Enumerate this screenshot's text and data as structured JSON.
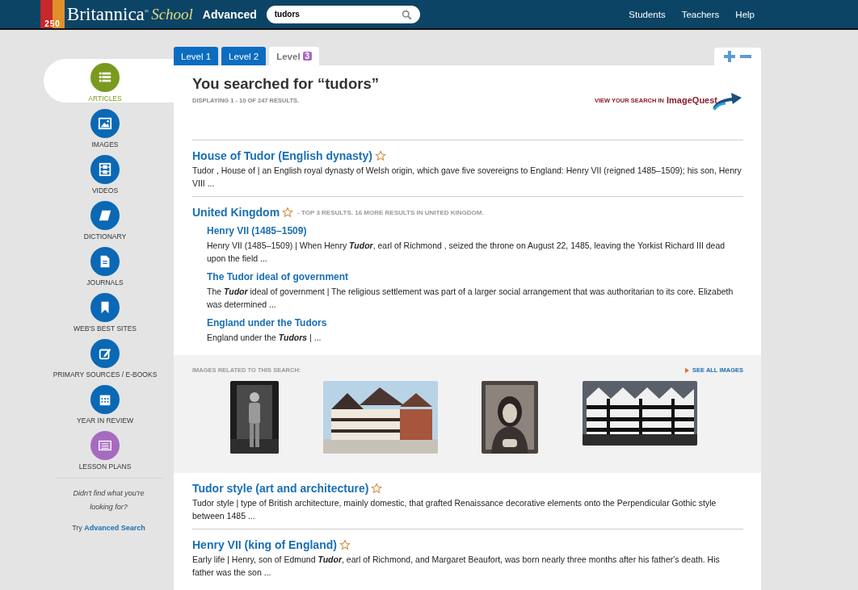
{
  "header": {
    "logo": {
      "anniversary": "250",
      "brand": "Britannica$^{®}$",
      "sub": "School"
    },
    "edition": "Advanced",
    "search": {
      "value": "tudors"
    },
    "nav": [
      "Students",
      "Teachers",
      "Help"
    ]
  },
  "tabs": [
    {
      "label": "Level 1",
      "selected": false
    },
    {
      "label": "Level 2",
      "selected": false
    },
    {
      "label": "Level",
      "badge": "3",
      "selected": true
    }
  ],
  "sidebar": {
    "items": [
      {
        "label": "ARTICLES",
        "color": "#7a9a1e",
        "selected": true
      },
      {
        "label": "IMAGES",
        "color": "#0b68b5",
        "selected": false
      },
      {
        "label": "VIDEOS",
        "color": "#0b68b5",
        "selected": false
      },
      {
        "label": "DICTIONARY",
        "color": "#0b68b5",
        "selected": false
      },
      {
        "label": "JOURNALS",
        "color": "#0b68b5",
        "selected": false
      },
      {
        "label": "WEB'S BEST SITES",
        "color": "#0b68b5",
        "selected": false
      },
      {
        "label": "PRIMARY SOURCES / E-BOOKS",
        "color": "#0b68b5",
        "selected": false
      },
      {
        "label": "YEAR IN REVIEW",
        "color": "#0b68b5",
        "selected": false
      },
      {
        "label": "LESSON PLANS",
        "color": "#a66bbf",
        "selected": false
      }
    ],
    "note": "Didn't find what you're looking for?",
    "try_prefix": "Try",
    "try_link": "Advanced Search"
  },
  "results_header": {
    "title": "You searched for “tudors”",
    "count": "DISPLAYING 1 - 10 OF 247 RESULTS.",
    "imagequest_prefix": "VIEW YOUR SEARCH IN",
    "imagequest_brand": "ImageQuest"
  },
  "results": [
    {
      "kind": "article",
      "title": "House of Tudor (English dynasty)",
      "text": "Tudor , House of  |   an English royal dynasty of Welsh origin, which gave five sovereigns to England: Henry VII (reigned 1485–1509); his son, Henry VIII ..."
    },
    {
      "kind": "group",
      "title": "United Kingdom",
      "note": "- TOP 3 RESULTS. 16 MORE RESULTS IN UNITED KINGDOM.",
      "children": [
        {
          "title": "Henry VII  (1485–1509)",
          "text": "Henry VII  (1485–1509)  | When Henry **Tudor**, earl of Richmond , seized the throne on August 22, 1485, leaving the Yorkist Richard III dead upon the field ..."
        },
        {
          "title": "The Tudor ideal of government",
          "text": "The **Tudor** ideal of government  | The religious settlement was part of a larger social arrangement that was authoritarian to its core. Elizabeth was determined ..."
        },
        {
          "title": "England under the Tudors",
          "text": "England under the **Tudors**   | ..."
        }
      ]
    },
    {
      "kind": "images",
      "label": "IMAGES RELATED TO THIS SEARCH:",
      "see_all": "SEE ALL IMAGES"
    },
    {
      "kind": "article",
      "title": "Tudor style (art and architecture)",
      "text": "Tudor style   |   type of British architecture, mainly domestic, that grafted Renaissance decorative elements onto the Perpendicular Gothic style  between 1485 ..."
    },
    {
      "kind": "article",
      "title": "Henry VII (king of England)",
      "text": "Early life  | Henry, son of Edmund **Tudor**, earl of Richmond, and Margaret Beaufort, was born nearly three months after his father's death. His father was the son ..."
    }
  ]
}
